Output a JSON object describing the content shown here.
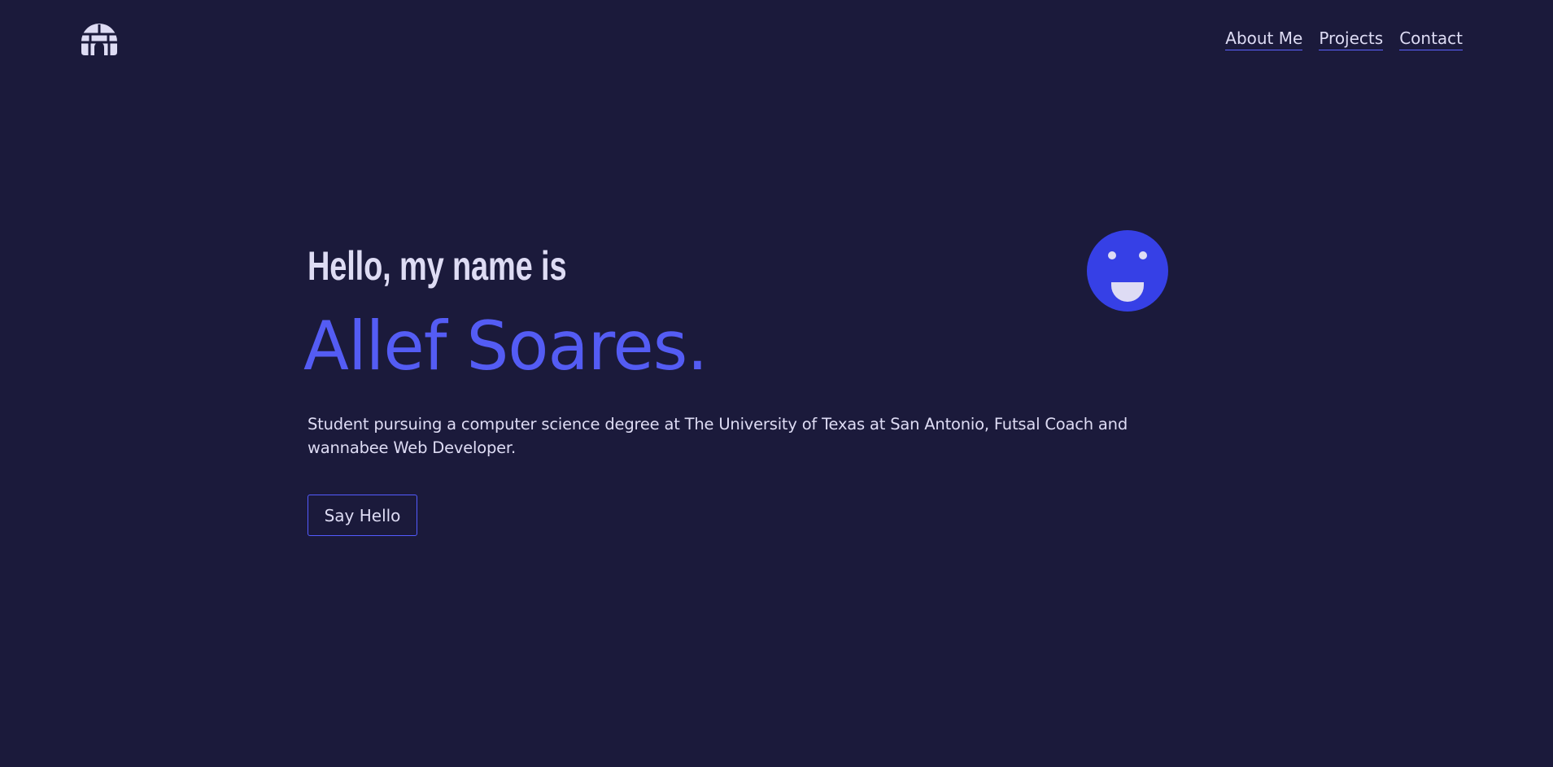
{
  "header": {
    "logo_icon": "igloo-icon",
    "nav": {
      "about_label": "About Me",
      "projects_label": "Projects",
      "contact_label": "Contact"
    }
  },
  "hero": {
    "greeting": "Hello, my name is",
    "name": "Allef Soares.",
    "description": "Student pursuing a computer science degree at The University of Texas at San Antonio, Futsal Coach and wannabee Web Developer.",
    "cta_label": "Say Hello",
    "avatar_icon": "smiley-face-icon"
  },
  "colors": {
    "background": "#1b1a3b",
    "text": "#dedcf4",
    "accent": "#545cf4",
    "button_border": "#535bff",
    "avatar_fill": "#3640e6"
  }
}
